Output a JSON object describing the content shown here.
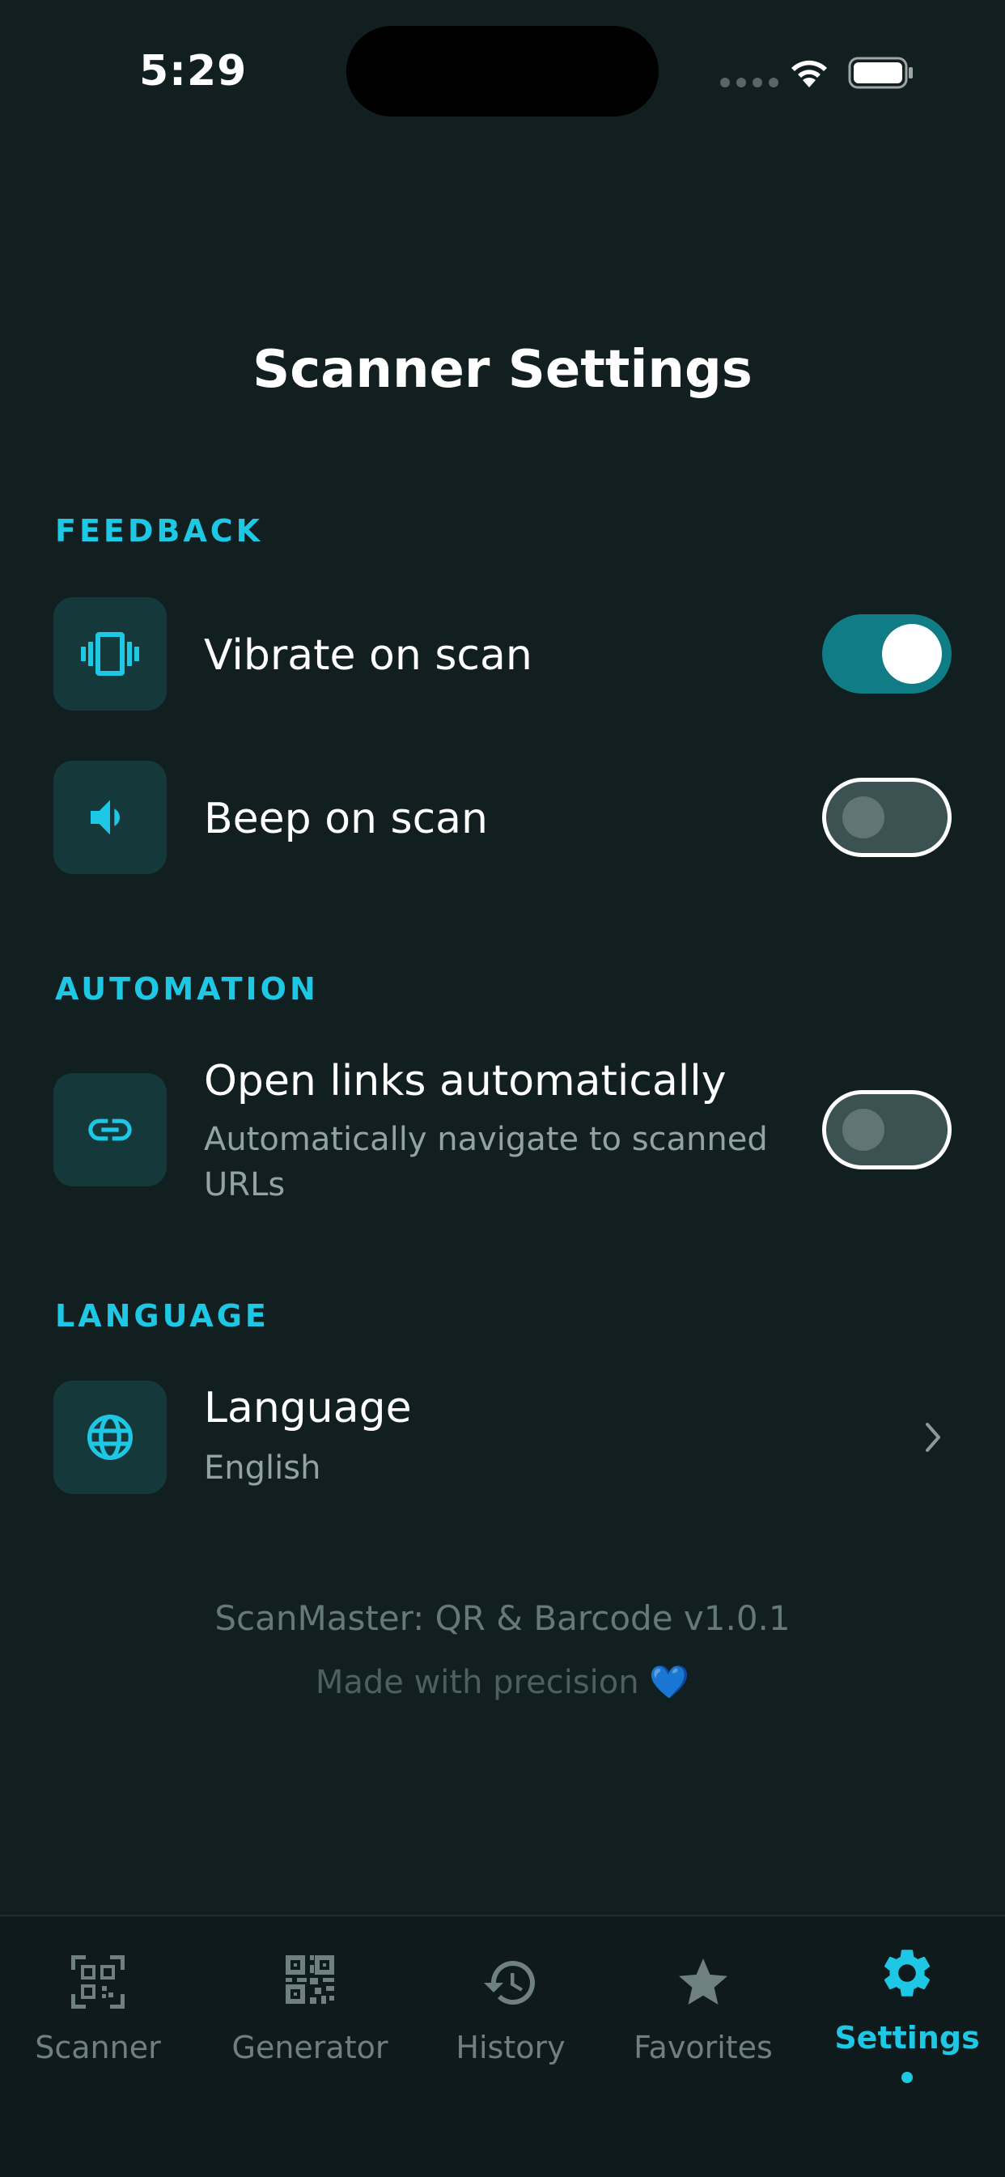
{
  "status_bar": {
    "time": "5:29"
  },
  "header": {
    "title": "Scanner Settings"
  },
  "sections": {
    "feedback": {
      "label": "FEEDBACK",
      "vibrate": {
        "title": "Vibrate on scan",
        "enabled": true,
        "icon": "vibrate-icon"
      },
      "beep": {
        "title": "Beep on scan",
        "enabled": false,
        "icon": "volume-icon"
      }
    },
    "automation": {
      "label": "AUTOMATION",
      "open_links": {
        "title": "Open links automatically",
        "subtitle": "Automatically navigate to scanned URLs",
        "enabled": false,
        "icon": "link-icon"
      }
    },
    "language": {
      "label": "LANGUAGE",
      "item": {
        "title": "Language",
        "value": "English",
        "icon": "globe-icon"
      }
    }
  },
  "footer": {
    "version": "ScanMaster: QR & Barcode v1.0.1",
    "made_with": "Made with precision 💙"
  },
  "tab_bar": {
    "tabs": [
      {
        "label": "Scanner",
        "icon": "qr-scan-icon",
        "active": false
      },
      {
        "label": "Generator",
        "icon": "qr-code-icon",
        "active": false
      },
      {
        "label": "History",
        "icon": "history-icon",
        "active": false
      },
      {
        "label": "Favorites",
        "icon": "star-icon",
        "active": false
      },
      {
        "label": "Settings",
        "icon": "gear-icon",
        "active": true
      }
    ]
  },
  "colors": {
    "background": "#111f20",
    "accent": "#1ec7e3",
    "toggle_on": "#0f7c86",
    "icon_box": "#15383b"
  }
}
